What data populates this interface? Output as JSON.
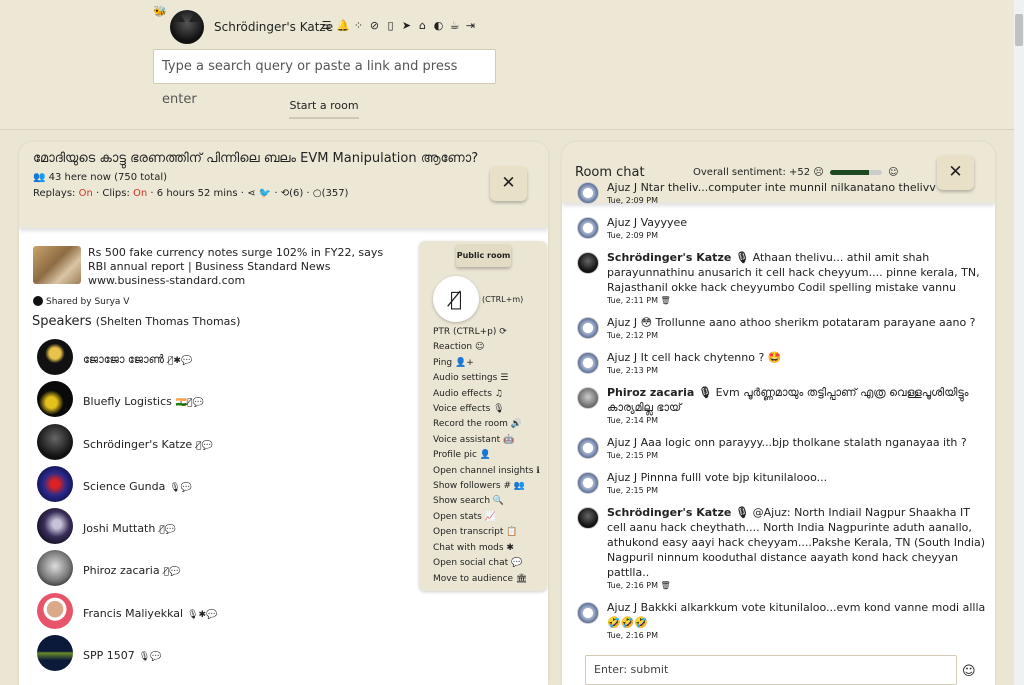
{
  "header": {
    "username": "Schrödinger's Katze",
    "search_placeholder": "Type a search query or paste a link and press enter",
    "start_room_label": "Start a room",
    "icons": [
      "sliders-icon",
      "bell-icon",
      "spinner-icon",
      "compass-icon",
      "bookmark-icon",
      "send-icon",
      "home-icon",
      "contrast-icon",
      "coffee-icon",
      "logout-icon"
    ]
  },
  "room": {
    "title": "മോദിയുടെ കാട്ടു ഭരണത്തിന് പിന്നിലെ ബലം EVM Manipulation ആണോ?",
    "listeners": "43 here now (750 total)",
    "replays_label": "Replays:",
    "replays_value": "On",
    "clips_label": "Clips:",
    "clips_value": "On",
    "duration": "6 hours 52 mins",
    "reposts": "(6)",
    "comments": "(357)",
    "link_title": "Rs 500 fake currency notes surge 102% in FY22, says RBI annual report | Business Standard News",
    "link_domain": "www.business-standard.com",
    "shared_by": "Shared by Surya V",
    "speakers_heading": "Speakers",
    "speakers_host": "(Shelten Thomas Thomas)",
    "speakers": [
      {
        "name": "ജോജോ ജോൺ",
        "status": "🎙̸✱💬"
      },
      {
        "name": "Bluefly Logistics",
        "status": "🇮🇳🎙̸💬"
      },
      {
        "name": "Schrödinger's Katze",
        "status": "🎙̸💬"
      },
      {
        "name": "Science Gunda",
        "status": "🎙💬"
      },
      {
        "name": "Joshi Muttath",
        "status": "🎙̸💬"
      },
      {
        "name": "Phiroz zacaria",
        "status": "🎙̸💬"
      },
      {
        "name": "Francis Maliyekkal",
        "status": "🎙✱💬"
      },
      {
        "name": "SPP 1507",
        "status": "🎙💬"
      }
    ],
    "public_room_label": "Public room",
    "mic_shortcut": "(CTRL+m)",
    "menu": [
      "PTR (CTRL+p) ⟳",
      "Reaction ☺",
      "Ping 👤+",
      "Audio settings ☰",
      "Audio effects ♫",
      "Voice effects 🎙",
      "Record the room 🔊",
      "Voice assistant 🤖",
      "Profile pic 👤",
      "Open channel insights ℹ",
      "Show followers # 👥",
      "Show search 🔍",
      "Open stats 📈",
      "Open transcript 📋",
      "Chat with mods ✱",
      "Open social chat 💬",
      "Move to audience 🏛"
    ]
  },
  "chat": {
    "title": "Room chat",
    "sentiment_label": "Overall sentiment: +52",
    "sentiment_fraction": 0.76,
    "input_placeholder": "Enter: submit",
    "messages": [
      {
        "who": "Ajuz J",
        "bold": false,
        "text": "Ntar theliv...computer inte munnil nilkanatano thelivv",
        "time": "Tue, 2:09 PM",
        "avatar": "ajuz"
      },
      {
        "who": "Ajuz J",
        "bold": false,
        "text": "Vayyyee",
        "time": "Tue, 2:09 PM",
        "avatar": "ajuz"
      },
      {
        "who": "Schrödinger's Katze 🎙",
        "bold": true,
        "text": "Athaan thelivu... athil amit shah parayunnathinu anusarich it cell hack cheyyum.... pinne kerala, TN, Rajasthanil okke hack cheyyumbo Codil spelling mistake vannu",
        "time": "Tue, 2:11 PM 🗑",
        "avatar": "sk"
      },
      {
        "who": "Ajuz J",
        "bold": false,
        "text": "😳 Trollunne aano athoo sherikm potataram parayane aano ?",
        "time": "Tue, 2:12 PM",
        "avatar": "ajuz"
      },
      {
        "who": "Ajuz J",
        "bold": false,
        "text": "It cell hack chytenno ? 🤩",
        "time": "Tue, 2:13 PM",
        "avatar": "ajuz"
      },
      {
        "who": "Phiroz zacaria 🎙",
        "bold": true,
        "text": "Evm പൂർണ്ണമായും തട്ടിപ്പാണ് എത്ര വെള്ളപൂശിയിട്ടും കാര്യമില്ല ഭായ്",
        "time": "Tue, 2:14 PM",
        "avatar": "ph"
      },
      {
        "who": "Ajuz J",
        "bold": false,
        "text": "Aaa logic onn parayyy...bjp tholkane stalath nganayaa ith ?",
        "time": "Tue, 2:15 PM",
        "avatar": "ajuz"
      },
      {
        "who": "Ajuz J",
        "bold": false,
        "text": "Pinnna fulll vote bjp kitunilalooo...",
        "time": "Tue, 2:15 PM",
        "avatar": "ajuz"
      },
      {
        "who": "Schrödinger's Katze 🎙",
        "bold": true,
        "text": "@Ajuz: North Indiail Nagpur Shaakha IT cell aanu hack cheythath.... North India Nagpurinte aduth aanallo, athukond easy aayi hack cheyyam....Pakshe Kerala, TN (South India) Nagpuril ninnum kooduthal distance aayath kond hack cheyyan pattlla..",
        "time": "Tue, 2:16 PM 🗑",
        "avatar": "sk"
      },
      {
        "who": "Ajuz J",
        "bold": false,
        "text": "Bakkki alkarkkum vote kitunilaloo...evm kond vanne modi allla 🤣🤣🤣",
        "time": "Tue, 2:16 PM",
        "avatar": "ajuz"
      }
    ]
  }
}
